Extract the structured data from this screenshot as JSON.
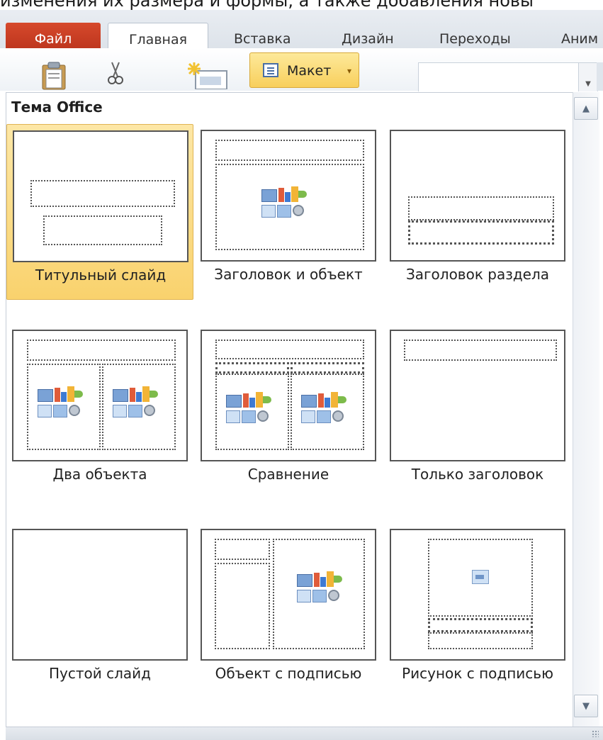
{
  "top_caption": "изменения их размера и формы, а также добавления новы",
  "tabs": {
    "file": "Файл",
    "home": "Главная",
    "insert": "Вставка",
    "design": "Дизайн",
    "transitions": "Переходы",
    "animations": "Аним"
  },
  "ribbon": {
    "layout_button": "Макет",
    "paste_icon": "clipboard-icon",
    "cut_icon": "scissors-icon",
    "new_slide_icon": "new-slide-icon"
  },
  "gallery": {
    "title": "Тема Office",
    "selected_index": 0,
    "layouts": [
      {
        "label": "Титульный слайд"
      },
      {
        "label": "Заголовок и объект"
      },
      {
        "label": "Заголовок раздела"
      },
      {
        "label": "Два объекта"
      },
      {
        "label": "Сравнение"
      },
      {
        "label": "Только заголовок"
      },
      {
        "label": "Пустой слайд"
      },
      {
        "label": "Объект с подписью"
      },
      {
        "label": "Рисунок с подписью"
      }
    ]
  },
  "colors": {
    "file_tab": "#c63d22",
    "selection": "#f9d26d",
    "accent_border": "#e0b453"
  }
}
